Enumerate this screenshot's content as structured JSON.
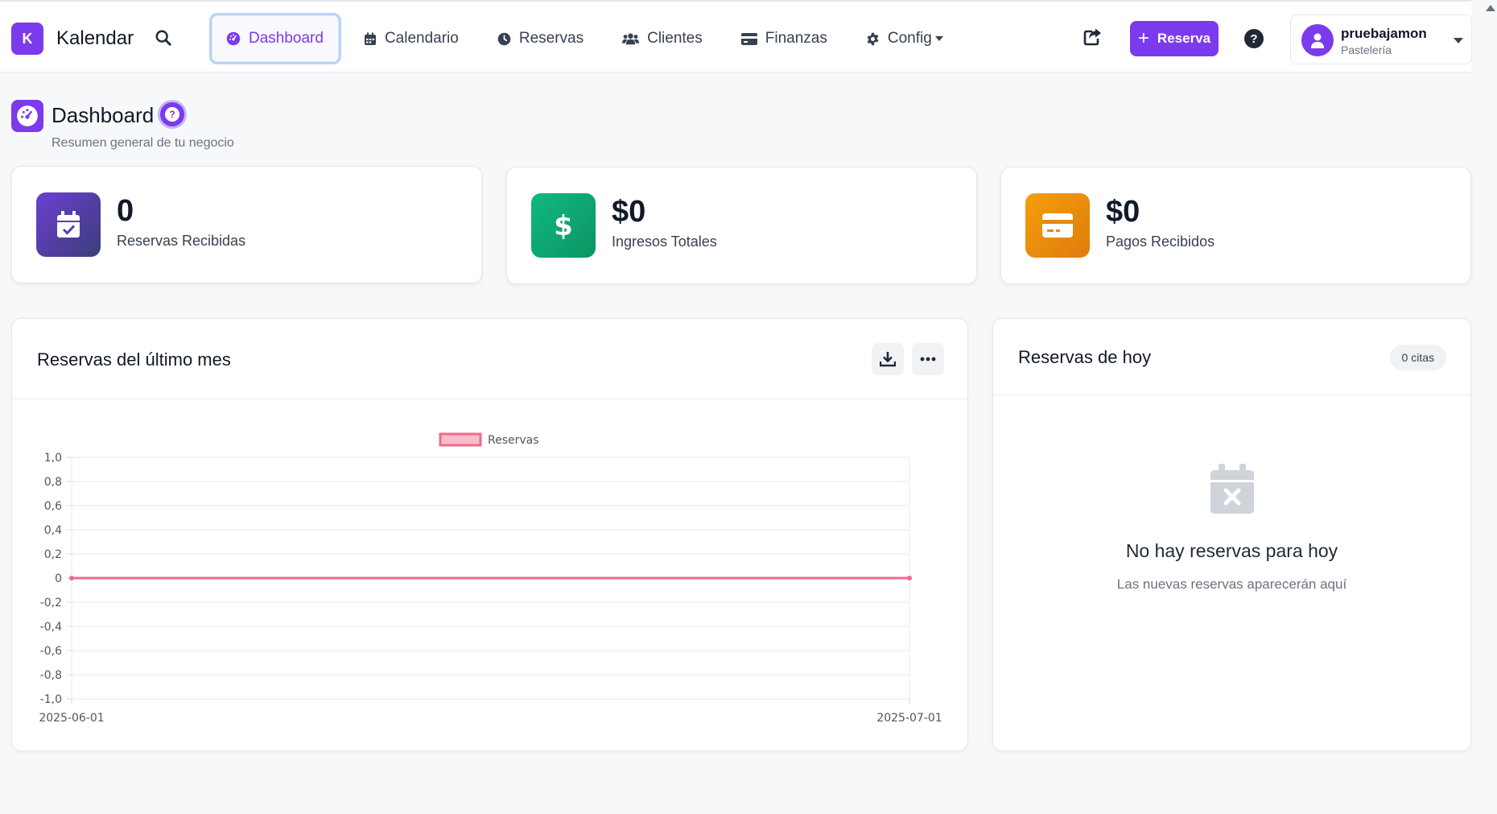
{
  "brand": {
    "logo_letter": "K",
    "name": "Kalendar"
  },
  "nav": {
    "items": [
      {
        "label": "Dashboard",
        "icon": "gauge-icon",
        "active": true
      },
      {
        "label": "Calendario",
        "icon": "calendar-icon"
      },
      {
        "label": "Reservas",
        "icon": "clock-icon"
      },
      {
        "label": "Clientes",
        "icon": "users-icon"
      },
      {
        "label": "Finanzas",
        "icon": "credit-card-icon"
      },
      {
        "label": "Config",
        "icon": "gear-icon",
        "dropdown": true
      }
    ]
  },
  "header_actions": {
    "new_reserva_label": "Reserva",
    "help_glyph": "?"
  },
  "user": {
    "name": "pruebajamon",
    "business": "Pastelería"
  },
  "page": {
    "title": "Dashboard",
    "subtitle": "Resumen general de tu negocio",
    "help_glyph": "?"
  },
  "stats": [
    {
      "value": "0",
      "label": "Reservas Recibidas",
      "icon": "calendar-check-icon",
      "color": "#6d3fd1"
    },
    {
      "value": "$0",
      "label": "Ingresos Totales",
      "icon": "dollar-icon",
      "color": "#10a872"
    },
    {
      "value": "$0",
      "label": "Pagos Recibidos",
      "icon": "credit-card-icon",
      "color": "#ec8a0e"
    }
  ],
  "chart_card": {
    "title": "Reservas del último mes"
  },
  "chart_data": {
    "type": "line",
    "series": [
      {
        "name": "Reservas",
        "x": [
          "2025-06-01",
          "2025-07-01"
        ],
        "values": [
          0,
          0
        ],
        "color": "#f16a8c"
      }
    ],
    "x_ticks": [
      "2025-06-01",
      "2025-07-01"
    ],
    "y_ticks": [
      "1,0",
      "0,8",
      "0,6",
      "0,4",
      "0,2",
      "0",
      "-0,2",
      "-0,4",
      "-0,6",
      "-0,8",
      "-1,0"
    ],
    "ylim": [
      -1,
      1
    ],
    "grid": true,
    "legend": "top-center"
  },
  "today": {
    "title": "Reservas de hoy",
    "badge": "0 citas",
    "empty_title": "No hay reservas para hoy",
    "empty_subtitle": "Las nuevas reservas aparecerán aquí"
  },
  "colors": {
    "accent": "#7c3aed",
    "focus_ring": "#b9d3f6"
  }
}
